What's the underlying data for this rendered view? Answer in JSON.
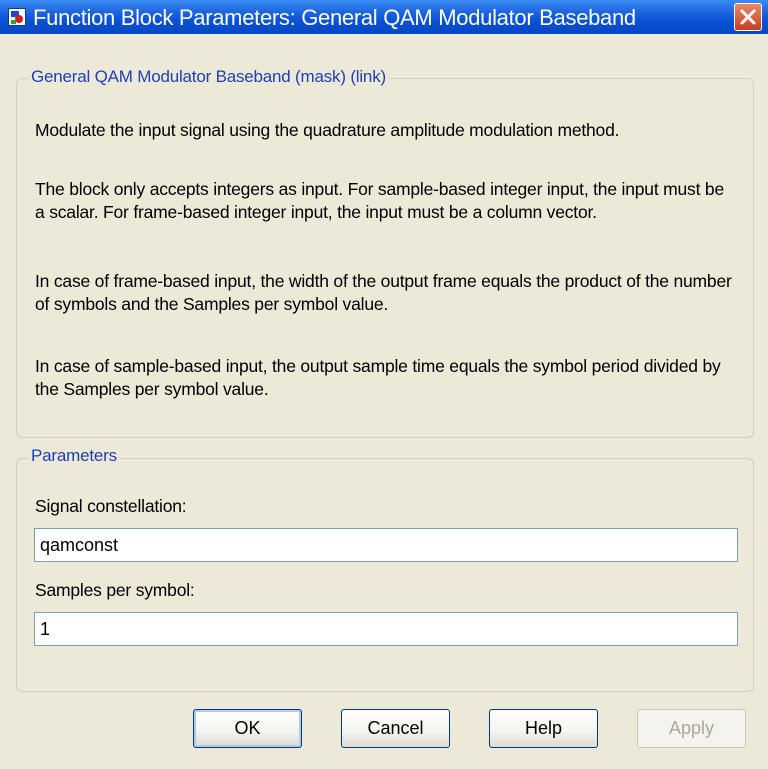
{
  "window": {
    "title": "Function Block Parameters: General QAM Modulator Baseband",
    "close_icon": "close-icon",
    "app_icon": "simulink-block-icon"
  },
  "description_group": {
    "legend": "General QAM Modulator Baseband (mask) (link)",
    "paragraphs": [
      "Modulate the input signal using the quadrature amplitude modulation method.",
      "The block only accepts integers as input. For sample-based integer input, the input must be a scalar. For frame-based integer input, the input must be a column vector.",
      "In case of frame-based input, the width of the output frame equals the product of the number of symbols and the Samples per symbol value.",
      "In case of sample-based input, the output sample time equals the symbol period divided by the Samples per symbol value."
    ]
  },
  "parameters_group": {
    "legend": "Parameters",
    "fields": [
      {
        "label": "Signal constellation:",
        "value": "qamconst"
      },
      {
        "label": "Samples per symbol:",
        "value": "1"
      }
    ]
  },
  "buttons": {
    "ok": "OK",
    "cancel": "Cancel",
    "help": "Help",
    "apply": "Apply"
  },
  "colors": {
    "titlebar": "#0a52d6",
    "dialog_bg": "#ece9d8",
    "legend_text": "#1f3eb8",
    "close_button": "#c63d1f"
  }
}
